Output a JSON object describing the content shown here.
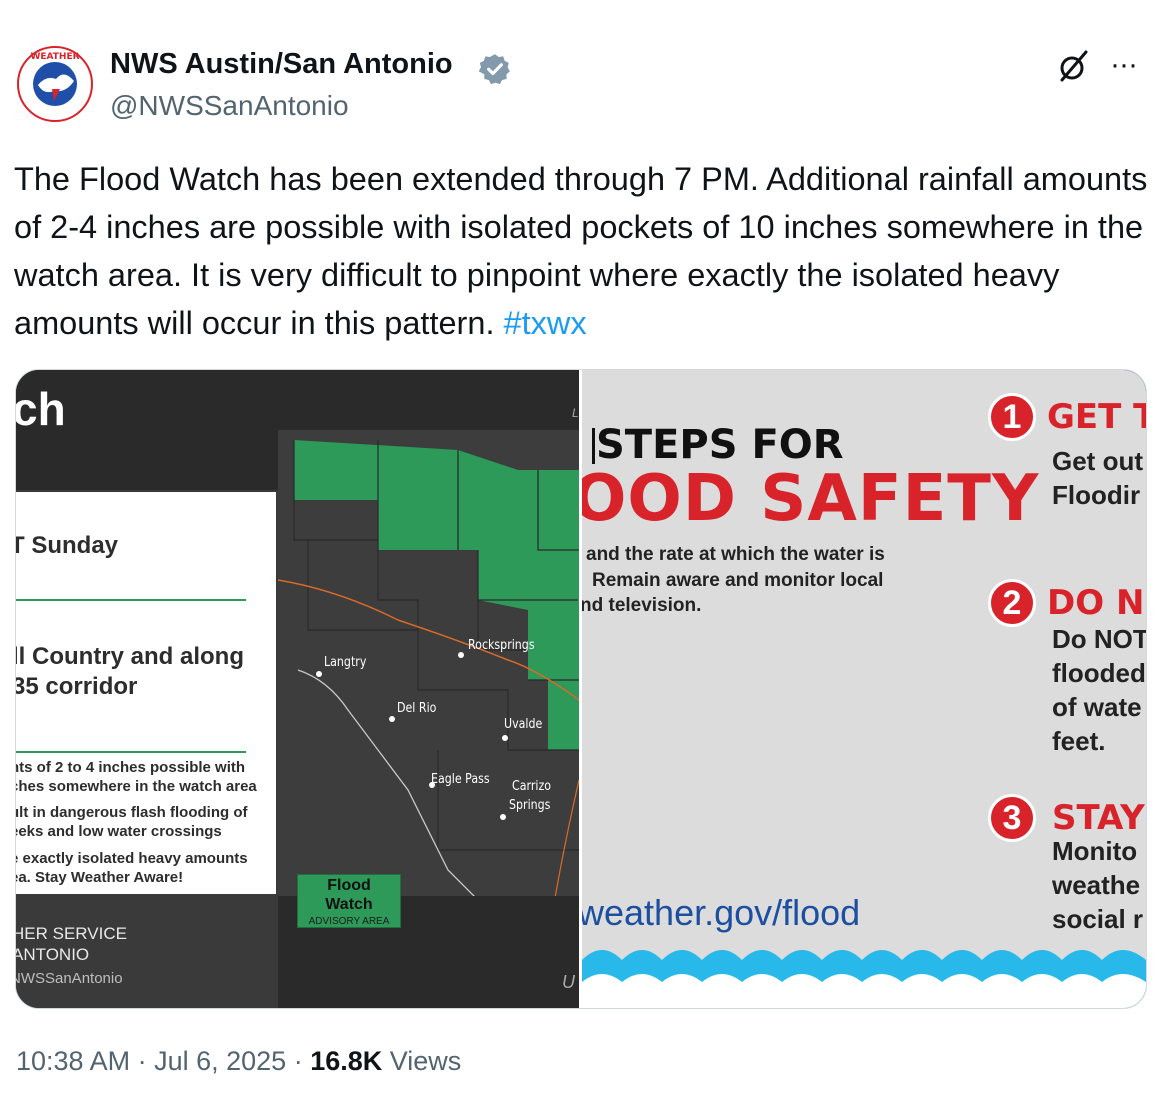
{
  "account": {
    "name": "NWS Austin/San Antonio",
    "handle": "@NWSSanAntonio",
    "avatar_icon": "nws-logo-icon",
    "verified_icon": "verified-badge-icon"
  },
  "actions": {
    "grok_icon": "grok-icon",
    "more_label": "···"
  },
  "tweet": {
    "text": "The Flood Watch has been extended through 7 PM. Additional rainfall amounts of 2-4 inches are possible with isolated pockets of 10 inches somewhere in the watch area. It is very difficult to pinpoint where exactly the isolated heavy amounts will occur in this pattern. ",
    "hashtag": "#txwx"
  },
  "image_left": {
    "title_fragment": "ch",
    "card": {
      "line1": "T Sunday",
      "line2a": "ll Country and along",
      "line2b": "35 corridor",
      "s1a": "nts of 2 to 4 inches possible with",
      "s1b": "ches somewhere in the watch area",
      "s2a": "ult in dangerous flash flooding of",
      "s2b": "eeks and low water crossings",
      "s3a": "e exactly isolated heavy amounts",
      "s3b": "ea. Stay Weather Aware!"
    },
    "footer": {
      "line1": "HER SERVICE",
      "line2": "ANTONIO",
      "line3": "NWSSanAntonio"
    },
    "legend": {
      "line1": "Flood",
      "line2": "Watch",
      "line3": "ADVISORY AREA"
    },
    "cities": {
      "langtry": "Langtry",
      "rocksprings": "Rocksprings",
      "del_rio": "Del Rio",
      "uvalde": "Uvalde",
      "eagle_pass": "Eagle Pass",
      "carrizo1": "Carrizo",
      "carrizo2": "Springs"
    },
    "edge_u": "U",
    "edge_l": "L"
  },
  "image_right": {
    "steps": "STEPS FOR",
    "flood_safety": "OOD SAFETY",
    "body1": "and the rate at which the water is",
    "body2": "Remain aware and monitor local",
    "body3": "nd television.",
    "url": "weather.gov/flood",
    "step1": {
      "num": "1",
      "head": "GET T",
      "d1": "Get out",
      "d2": "Floodir"
    },
    "step2": {
      "num": "2",
      "head": "DO NO",
      "d1": "Do NOT",
      "d2": "flooded",
      "d3": "of wate",
      "d4": "feet."
    },
    "step3": {
      "num": "3",
      "head": "STAY",
      "d1": "Monito",
      "d2": "weathe",
      "d3": "social r"
    }
  },
  "meta": {
    "time": "10:38 AM",
    "sep1": " · ",
    "date": "Jul 6, 2025",
    "sep2": " · ",
    "views_count": "16.8K",
    "views_label": " Views"
  },
  "colors": {
    "accent": "#1d9bf0",
    "flood_watch_green": "#2e9a5a",
    "safety_red": "#d8232a"
  }
}
